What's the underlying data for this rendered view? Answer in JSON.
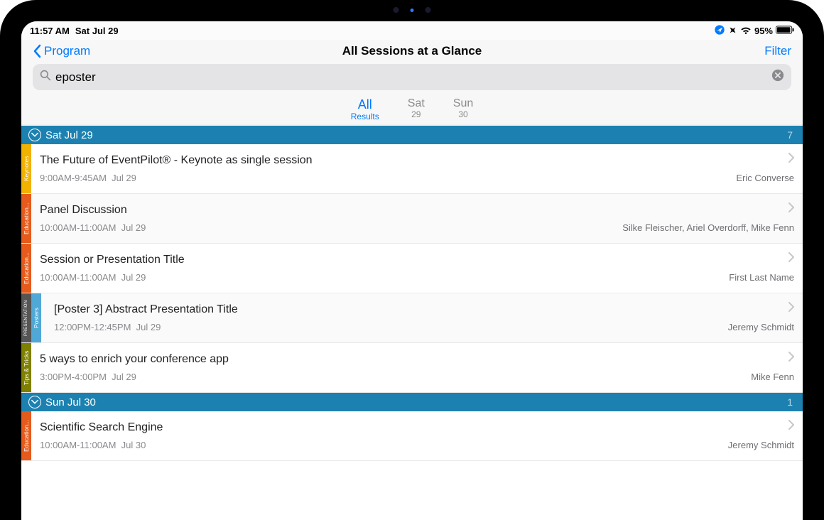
{
  "status": {
    "time": "11:57 AM",
    "date": "Sat Jul 29",
    "battery_pct": "95%"
  },
  "nav": {
    "back_label": "Program",
    "title": "All Sessions at a Glance",
    "filter_label": "Filter"
  },
  "search": {
    "value": "eposter"
  },
  "tabs": [
    {
      "top": "All",
      "bottom": "Results"
    },
    {
      "top": "Sat",
      "bottom": "29"
    },
    {
      "top": "Sun",
      "bottom": "30"
    }
  ],
  "days": [
    {
      "label": "Sat Jul 29",
      "count": "7",
      "sessions": [
        {
          "tags": [
            {
              "label": "Keynotes",
              "cls": "keynotes"
            }
          ],
          "title": "The Future of EventPilot® - Keynote as single session",
          "time": "9:00AM-9:45AM",
          "date": "Jul 29",
          "speakers": "Eric Converse",
          "alt": false
        },
        {
          "tags": [
            {
              "label": "Education...",
              "cls": "education"
            }
          ],
          "title": "Panel Discussion",
          "time": "10:00AM-11:00AM",
          "date": "Jul 29",
          "speakers": "Silke Fleischer, Ariel Overdorff, Mike Fenn",
          "alt": true
        },
        {
          "tags": [
            {
              "label": "Education...",
              "cls": "education"
            }
          ],
          "title": "Session or Presentation Title",
          "time": "10:00AM-11:00AM",
          "date": "Jul 29",
          "speakers": "First Last Name",
          "alt": false
        },
        {
          "tags": [
            {
              "label": "PRESENTATION",
              "cls": "presentation"
            },
            {
              "label": "Posters",
              "cls": "posters"
            }
          ],
          "title": "[Poster 3] Abstract Presentation Title",
          "time": "12:00PM-12:45PM",
          "date": "Jul 29",
          "speakers": "Jeremy Schmidt",
          "alt": true,
          "indent": true
        },
        {
          "tags": [
            {
              "label": "Tips & Tricks",
              "cls": "tips"
            }
          ],
          "title": "5 ways to enrich your conference app",
          "time": "3:00PM-4:00PM",
          "date": "Jul 29",
          "speakers": "Mike Fenn",
          "alt": false
        }
      ]
    },
    {
      "label": "Sun Jul 30",
      "count": "1",
      "sessions": [
        {
          "tags": [
            {
              "label": "Education...",
              "cls": "education"
            }
          ],
          "title": "Scientific Search Engine",
          "time": "10:00AM-11:00AM",
          "date": "Jul 30",
          "speakers": "Jeremy Schmidt",
          "alt": false
        }
      ]
    }
  ]
}
